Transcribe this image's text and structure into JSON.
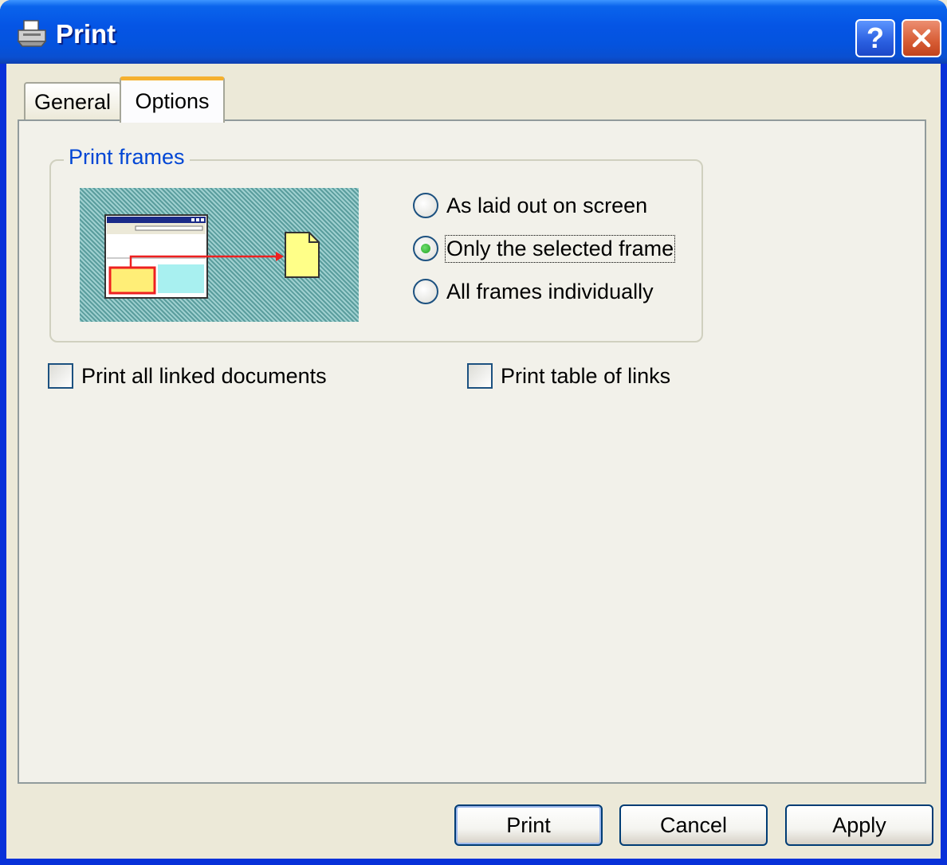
{
  "window": {
    "title": "Print",
    "help_label": "?"
  },
  "tabs": [
    {
      "label": "General",
      "selected": false
    },
    {
      "label": "Options",
      "selected": true
    }
  ],
  "print_frames": {
    "label": "Print frames",
    "options": [
      {
        "label": "As laid out on screen",
        "selected": false
      },
      {
        "label": "Only the selected frame",
        "selected": true
      },
      {
        "label": "All frames individually",
        "selected": false
      }
    ]
  },
  "checkboxes": {
    "linked_docs": {
      "label": "Print all linked documents",
      "checked": false
    },
    "table_of_links": {
      "label": "Print table of links",
      "checked": false
    }
  },
  "buttons": {
    "print": "Print",
    "cancel": "Cancel",
    "apply": "Apply"
  },
  "colors": {
    "titlebar": "#0555e5",
    "frame_border": "#0831d9",
    "groupbox_label": "#0046d5",
    "tab_highlight": "#f5b02e",
    "radio_selected": "#21a121"
  }
}
